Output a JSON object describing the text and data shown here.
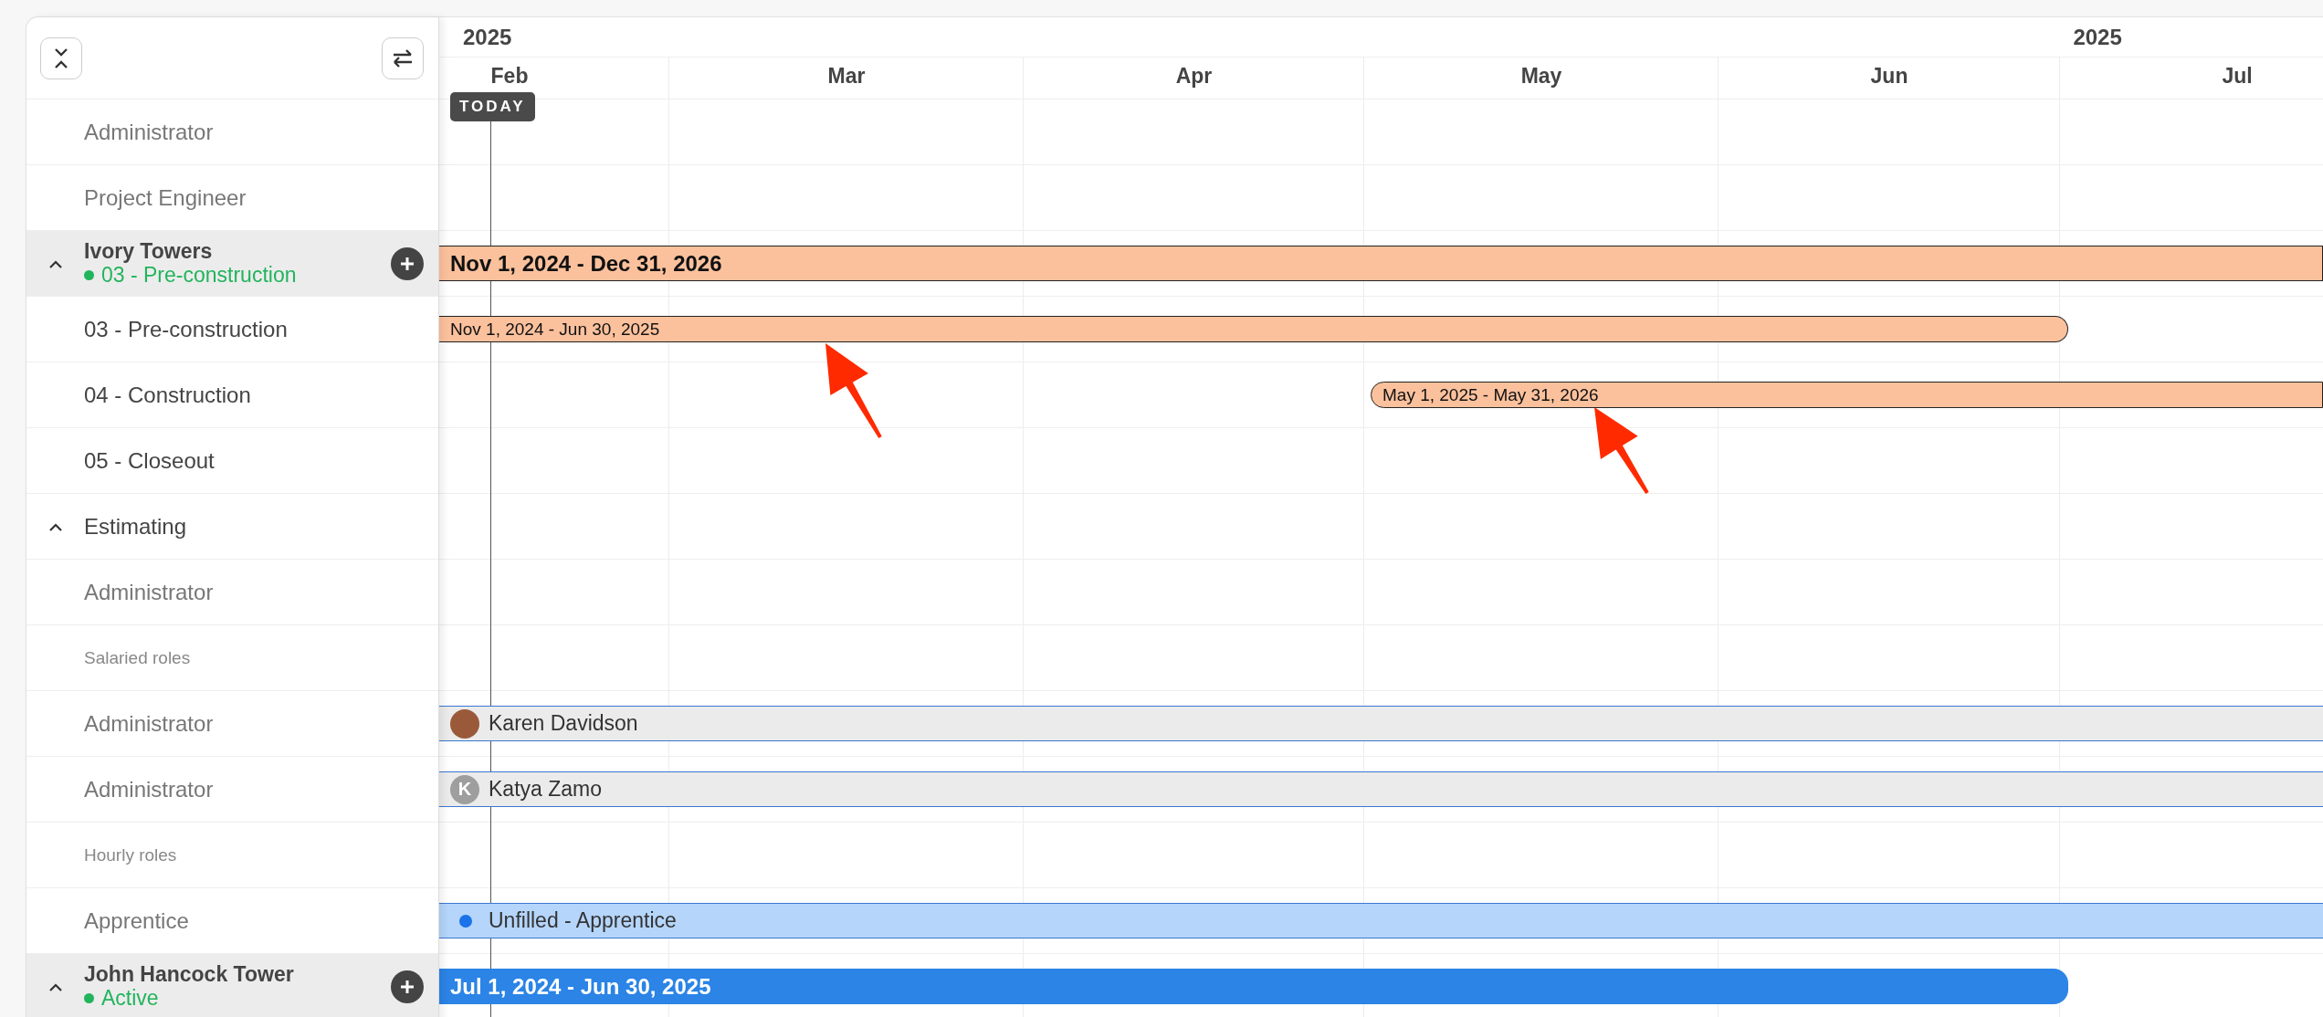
{
  "header": {
    "years": [
      "2025",
      "2025"
    ],
    "months": [
      "Feb",
      "Mar",
      "Apr",
      "May",
      "Jun",
      "Jul"
    ],
    "today": "TODAY"
  },
  "rows": [
    {
      "kind": "role",
      "label": "Administrator"
    },
    {
      "kind": "role",
      "label": "Project Engineer"
    },
    {
      "kind": "project",
      "label": "Ivory Towers",
      "status": "03 - Pre-construction",
      "expanded": true,
      "bar": {
        "kind": "project",
        "label": "Nov 1, 2024 - Dec 31, 2026",
        "color": "#fbc19d"
      }
    },
    {
      "kind": "phase",
      "label": "03 - Pre-construction",
      "bar": {
        "kind": "phase",
        "label": "Nov 1, 2024 - Jun 30, 2025",
        "color": "#fbc19d"
      }
    },
    {
      "kind": "phase",
      "label": "04 - Construction",
      "bar": {
        "kind": "phase",
        "label": "May 1, 2025 - May 31, 2026",
        "color": "#fbc19d"
      }
    },
    {
      "kind": "phase",
      "label": "05 - Closeout"
    },
    {
      "kind": "section",
      "label": "Estimating",
      "expanded": true
    },
    {
      "kind": "role",
      "label": "Administrator"
    },
    {
      "kind": "subheading",
      "label": "Salaried roles"
    },
    {
      "kind": "role",
      "label": "Administrator",
      "bar": {
        "kind": "assignee",
        "label": "Karen Davidson",
        "avatar": {
          "kind": "photo"
        }
      }
    },
    {
      "kind": "role",
      "label": "Administrator",
      "bar": {
        "kind": "assignee",
        "label": "Katya Zamo",
        "avatar": {
          "kind": "initial",
          "initial": "K"
        }
      }
    },
    {
      "kind": "subheading",
      "label": "Hourly roles"
    },
    {
      "kind": "role",
      "label": "Apprentice",
      "bar": {
        "kind": "unfilled",
        "label": "Unfilled - Apprentice"
      }
    },
    {
      "kind": "project",
      "label": "John Hancock Tower",
      "status": "Active",
      "expanded": true,
      "bar": {
        "kind": "project",
        "label": "Jul 1, 2024 - Jun 30, 2025",
        "color": "#2b84e6"
      }
    }
  ],
  "annotations": [
    {
      "kind": "arrow"
    },
    {
      "kind": "arrow"
    }
  ]
}
